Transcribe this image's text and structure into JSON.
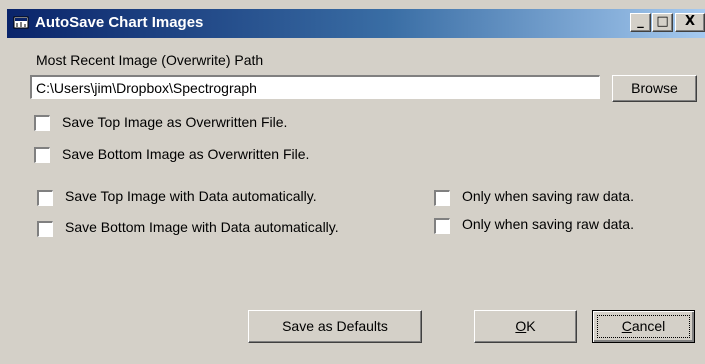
{
  "window": {
    "title": "AutoSave Chart Images",
    "controls": {
      "minimize": "_",
      "maximize": "□",
      "close": "X"
    }
  },
  "path": {
    "label": "Most Recent Image (Overwrite) Path",
    "value": "C:\\Users\\jim\\Dropbox\\Spectrograph",
    "browse_label": "Browse"
  },
  "checkboxes": {
    "top_overwrite": {
      "label": "Save Top Image as Overwritten File.",
      "checked": false
    },
    "bottom_overwrite": {
      "label": "Save Bottom Image as Overwritten File.",
      "checked": false
    },
    "top_auto": {
      "label": "Save Top Image with Data automatically.",
      "checked": false
    },
    "bottom_auto": {
      "label": "Save Bottom Image with Data automatically.",
      "checked": false
    },
    "top_raw_only": {
      "label": "Only when saving raw data.",
      "checked": false
    },
    "bottom_raw_only": {
      "label": "Only when saving raw data.",
      "checked": false
    }
  },
  "buttons": {
    "save_defaults": "Save as Defaults",
    "ok_mnemonic": "O",
    "ok_rest": "K",
    "cancel_mnemonic": "C",
    "cancel_rest": "ancel"
  },
  "colors": {
    "face": "#d4d0c8",
    "title_start": "#0a246a",
    "title_end": "#a6caf0"
  }
}
